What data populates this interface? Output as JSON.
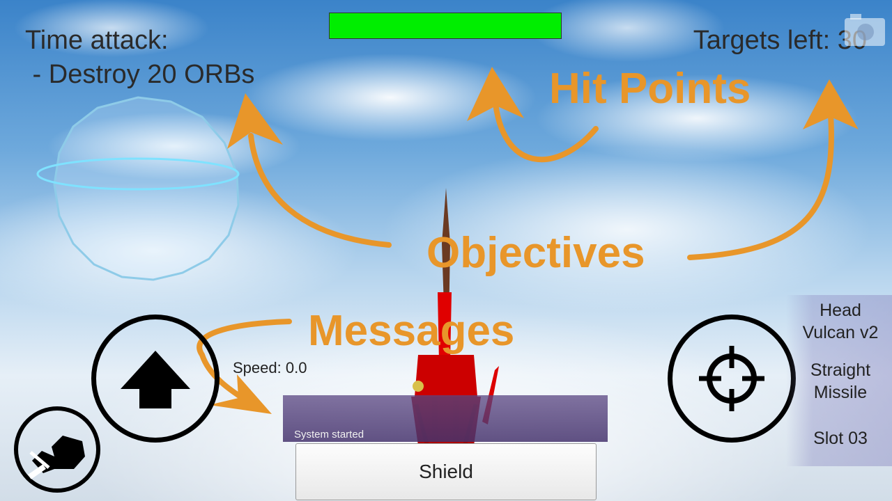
{
  "hud": {
    "objective": "Time attack:\n - Destroy 20 ORBs",
    "targets": "Targets left: 30",
    "hp_fraction": 1.0,
    "speed": "Speed: 0.0",
    "message": "System started",
    "shield_label": "Shield"
  },
  "weapons": [
    {
      "label": "Head\nVulcan v2"
    },
    {
      "label": "Straight\nMissile"
    },
    {
      "label": "Slot 03"
    }
  ],
  "annotations": {
    "hit_points": "Hit Points",
    "objectives": "Objectives",
    "messages": "Messages"
  },
  "colors": {
    "accent": "#e8962a",
    "hp_fill": "#00ee00",
    "message_panel": "#5a4682",
    "mech": "#e00000"
  },
  "icons": [
    "camera-icon",
    "up-arrow-icon",
    "crosshair-icon",
    "dock-icon"
  ]
}
